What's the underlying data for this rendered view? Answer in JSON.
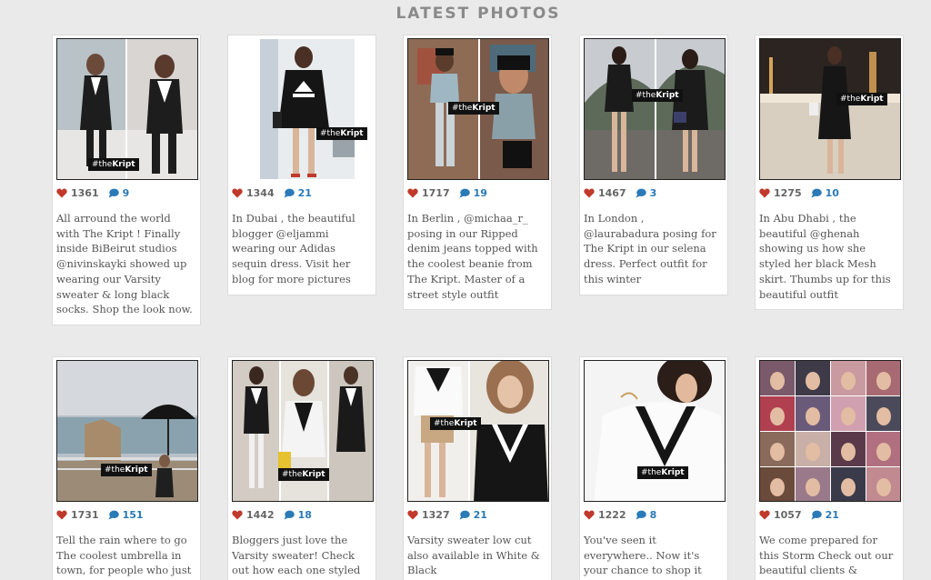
{
  "section": {
    "title": "LATEST PHOTOS"
  },
  "posts": [
    {
      "likes": "1361",
      "comments": "9",
      "tag_hash": "#",
      "tag_prefix": "the",
      "tag_brand": "Kript",
      "caption": "All arround the world with The Kript ! Finally inside BiBeirut studios @nivinskayki showed up wearing our Varsity sweater & long black socks. Shop the look now."
    },
    {
      "likes": "1344",
      "comments": "21",
      "tag_hash": "#",
      "tag_prefix": "the",
      "tag_brand": "Kript",
      "caption": "In Dubai , the beautiful blogger @eljammi wearing our Adidas sequin dress. Visit her blog for more pictures"
    },
    {
      "likes": "1717",
      "comments": "19",
      "tag_hash": "#",
      "tag_prefix": "the",
      "tag_brand": "Kript",
      "caption": "In Berlin , @michaa_r_ posing in our Ripped denim jeans topped with the coolest beanie from The Kript. Master of a street style outfit"
    },
    {
      "likes": "1467",
      "comments": "3",
      "tag_hash": "#",
      "tag_prefix": "the",
      "tag_brand": "Kript",
      "caption": "In London , @laurabadura posing for The Kript in our selena dress. Perfect outfit for this winter"
    },
    {
      "likes": "1275",
      "comments": "10",
      "tag_hash": "#",
      "tag_prefix": "the",
      "tag_brand": "Kript",
      "caption": "In Abu Dhabi , the beautiful @ghenah showing us how she styled her black Mesh skirt. Thumbs up for this beautiful outfit"
    },
    {
      "likes": "1731",
      "comments": "151",
      "tag_hash": "#",
      "tag_prefix": "the",
      "tag_brand": "Kript",
      "caption": "Tell the rain where to go The coolest umbrella in town, for people who just"
    },
    {
      "likes": "1442",
      "comments": "18",
      "tag_hash": "#",
      "tag_prefix": "the",
      "tag_brand": "Kript",
      "caption": "Bloggers just love the Varsity sweater! Check out how each one styled their"
    },
    {
      "likes": "1327",
      "comments": "21",
      "tag_hash": "#",
      "tag_prefix": "the",
      "tag_brand": "Kript",
      "caption": "Varsity sweater low cut also available in White & Black"
    },
    {
      "likes": "1222",
      "comments": "8",
      "tag_hash": "#",
      "tag_prefix": "the",
      "tag_brand": "Kript",
      "caption": "You've seen it everywhere.. Now it's your chance to shop it @thekript . Our"
    },
    {
      "likes": "1057",
      "comments": "21",
      "tag_hash": "#",
      "tag_prefix": "the",
      "tag_brand": "Kript",
      "caption": "We come prepared for this Storm Check out our beautiful clients & bloggers"
    }
  ],
  "icons": {
    "like": "heart-icon",
    "comment": "speech-bubble-icon"
  },
  "colors": {
    "like": "#c0392b",
    "comment": "#2a7ab8",
    "title": "#8a8a8a"
  }
}
